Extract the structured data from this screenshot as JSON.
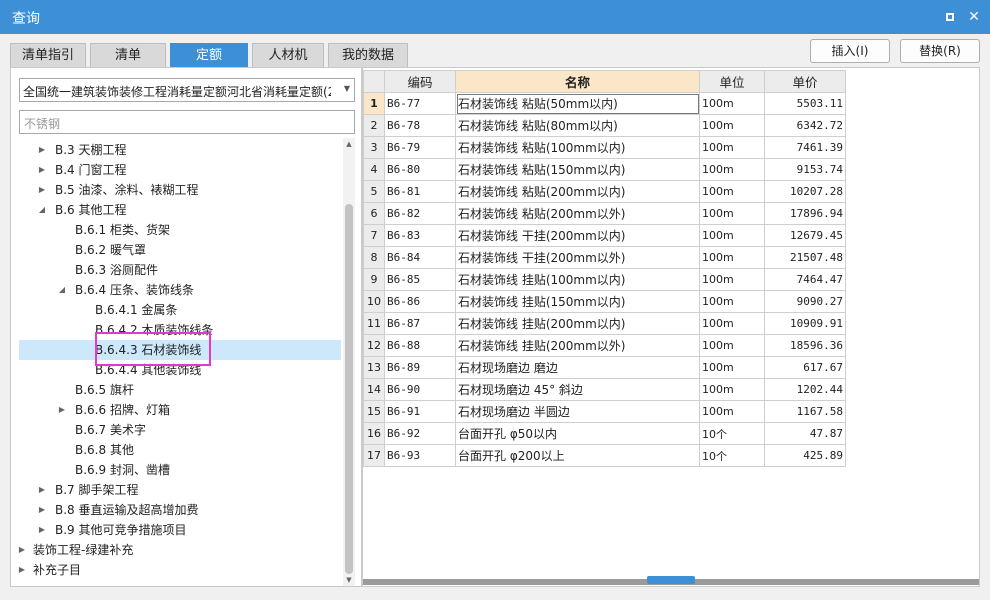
{
  "window": {
    "title": "查询"
  },
  "tabs": [
    {
      "label": "清单指引",
      "active": false
    },
    {
      "label": "清单",
      "active": false
    },
    {
      "label": "定额",
      "active": true
    },
    {
      "label": "人材机",
      "active": false
    },
    {
      "label": "我的数据",
      "active": false
    }
  ],
  "buttons": {
    "insert": "插入(I)",
    "replace": "替换(R)"
  },
  "left": {
    "library_select": "全国统一建筑装饰装修工程消耗量定额河北省消耗量定额(2012)",
    "search_placeholder": "不锈钢",
    "tree": [
      {
        "label": "B.3 天棚工程",
        "level": 1,
        "toggle": "▶"
      },
      {
        "label": "B.4 门窗工程",
        "level": 1,
        "toggle": "▶"
      },
      {
        "label": "B.5 油漆、涂料、裱糊工程",
        "level": 1,
        "toggle": "▶"
      },
      {
        "label": "B.6 其他工程",
        "level": 1,
        "toggle": "◢"
      },
      {
        "label": "B.6.1 柜类、货架",
        "level": 2,
        "toggle": ""
      },
      {
        "label": "B.6.2 暖气罩",
        "level": 2,
        "toggle": ""
      },
      {
        "label": "B.6.3 浴厕配件",
        "level": 2,
        "toggle": ""
      },
      {
        "label": "B.6.4 压条、装饰线条",
        "level": 2,
        "toggle": "◢"
      },
      {
        "label": "B.6.4.1 金属条",
        "level": 3,
        "toggle": ""
      },
      {
        "label": "B.6.4.2 木质装饰线条",
        "level": 3,
        "toggle": ""
      },
      {
        "label": "B.6.4.3 石材装饰线",
        "level": 3,
        "toggle": "",
        "selected": true
      },
      {
        "label": "B.6.4.4 其他装饰线",
        "level": 3,
        "toggle": ""
      },
      {
        "label": "B.6.5 旗杆",
        "level": 2,
        "toggle": ""
      },
      {
        "label": "B.6.6 招牌、灯箱",
        "level": 2,
        "toggle": "▶"
      },
      {
        "label": "B.6.7 美术字",
        "level": 2,
        "toggle": ""
      },
      {
        "label": "B.6.8 其他",
        "level": 2,
        "toggle": ""
      },
      {
        "label": "B.6.9 封洞、凿槽",
        "level": 2,
        "toggle": ""
      },
      {
        "label": "B.7 脚手架工程",
        "level": 1,
        "toggle": "▶"
      },
      {
        "label": "B.8 垂直运输及超高增加费",
        "level": 1,
        "toggle": "▶"
      },
      {
        "label": "B.9 其他可竞争措施项目",
        "level": 1,
        "toggle": "▶"
      },
      {
        "label": "装饰工程-绿建补充",
        "level": 0,
        "toggle": "▶"
      },
      {
        "label": "补充子目",
        "level": 0,
        "toggle": "▶"
      }
    ]
  },
  "grid": {
    "headers": {
      "code": "编码",
      "name": "名称",
      "unit": "单位",
      "price": "单价"
    },
    "rows": [
      {
        "no": "1",
        "code": "B6-77",
        "name": "石材装饰线 粘贴(50mm以内)",
        "unit": "100m",
        "price": "5503.11"
      },
      {
        "no": "2",
        "code": "B6-78",
        "name": "石材装饰线 粘贴(80mm以内)",
        "unit": "100m",
        "price": "6342.72"
      },
      {
        "no": "3",
        "code": "B6-79",
        "name": "石材装饰线 粘贴(100mm以内)",
        "unit": "100m",
        "price": "7461.39"
      },
      {
        "no": "4",
        "code": "B6-80",
        "name": "石材装饰线 粘贴(150mm以内)",
        "unit": "100m",
        "price": "9153.74"
      },
      {
        "no": "5",
        "code": "B6-81",
        "name": "石材装饰线 粘贴(200mm以内)",
        "unit": "100m",
        "price": "10207.28"
      },
      {
        "no": "6",
        "code": "B6-82",
        "name": "石材装饰线 粘贴(200mm以外)",
        "unit": "100m",
        "price": "17896.94"
      },
      {
        "no": "7",
        "code": "B6-83",
        "name": "石材装饰线 干挂(200mm以内)",
        "unit": "100m",
        "price": "12679.45"
      },
      {
        "no": "8",
        "code": "B6-84",
        "name": "石材装饰线 干挂(200mm以外)",
        "unit": "100m",
        "price": "21507.48"
      },
      {
        "no": "9",
        "code": "B6-85",
        "name": "石材装饰线 挂贴(100mm以内)",
        "unit": "100m",
        "price": "7464.47"
      },
      {
        "no": "10",
        "code": "B6-86",
        "name": "石材装饰线 挂贴(150mm以内)",
        "unit": "100m",
        "price": "9090.27"
      },
      {
        "no": "11",
        "code": "B6-87",
        "name": "石材装饰线 挂贴(200mm以内)",
        "unit": "100m",
        "price": "10909.91"
      },
      {
        "no": "12",
        "code": "B6-88",
        "name": "石材装饰线 挂贴(200mm以外)",
        "unit": "100m",
        "price": "18596.36"
      },
      {
        "no": "13",
        "code": "B6-89",
        "name": "石材现场磨边 磨边",
        "unit": "100m",
        "price": "617.67"
      },
      {
        "no": "14",
        "code": "B6-90",
        "name": "石材现场磨边 45° 斜边",
        "unit": "100m",
        "price": "1202.44"
      },
      {
        "no": "15",
        "code": "B6-91",
        "name": "石材现场磨边 半圆边",
        "unit": "100m",
        "price": "1167.58"
      },
      {
        "no": "16",
        "code": "B6-92",
        "name": "台面开孔 φ50以内",
        "unit": "10个",
        "price": "47.87"
      },
      {
        "no": "17",
        "code": "B6-93",
        "name": "台面开孔 φ200以上",
        "unit": "10个",
        "price": "425.89"
      }
    ]
  }
}
